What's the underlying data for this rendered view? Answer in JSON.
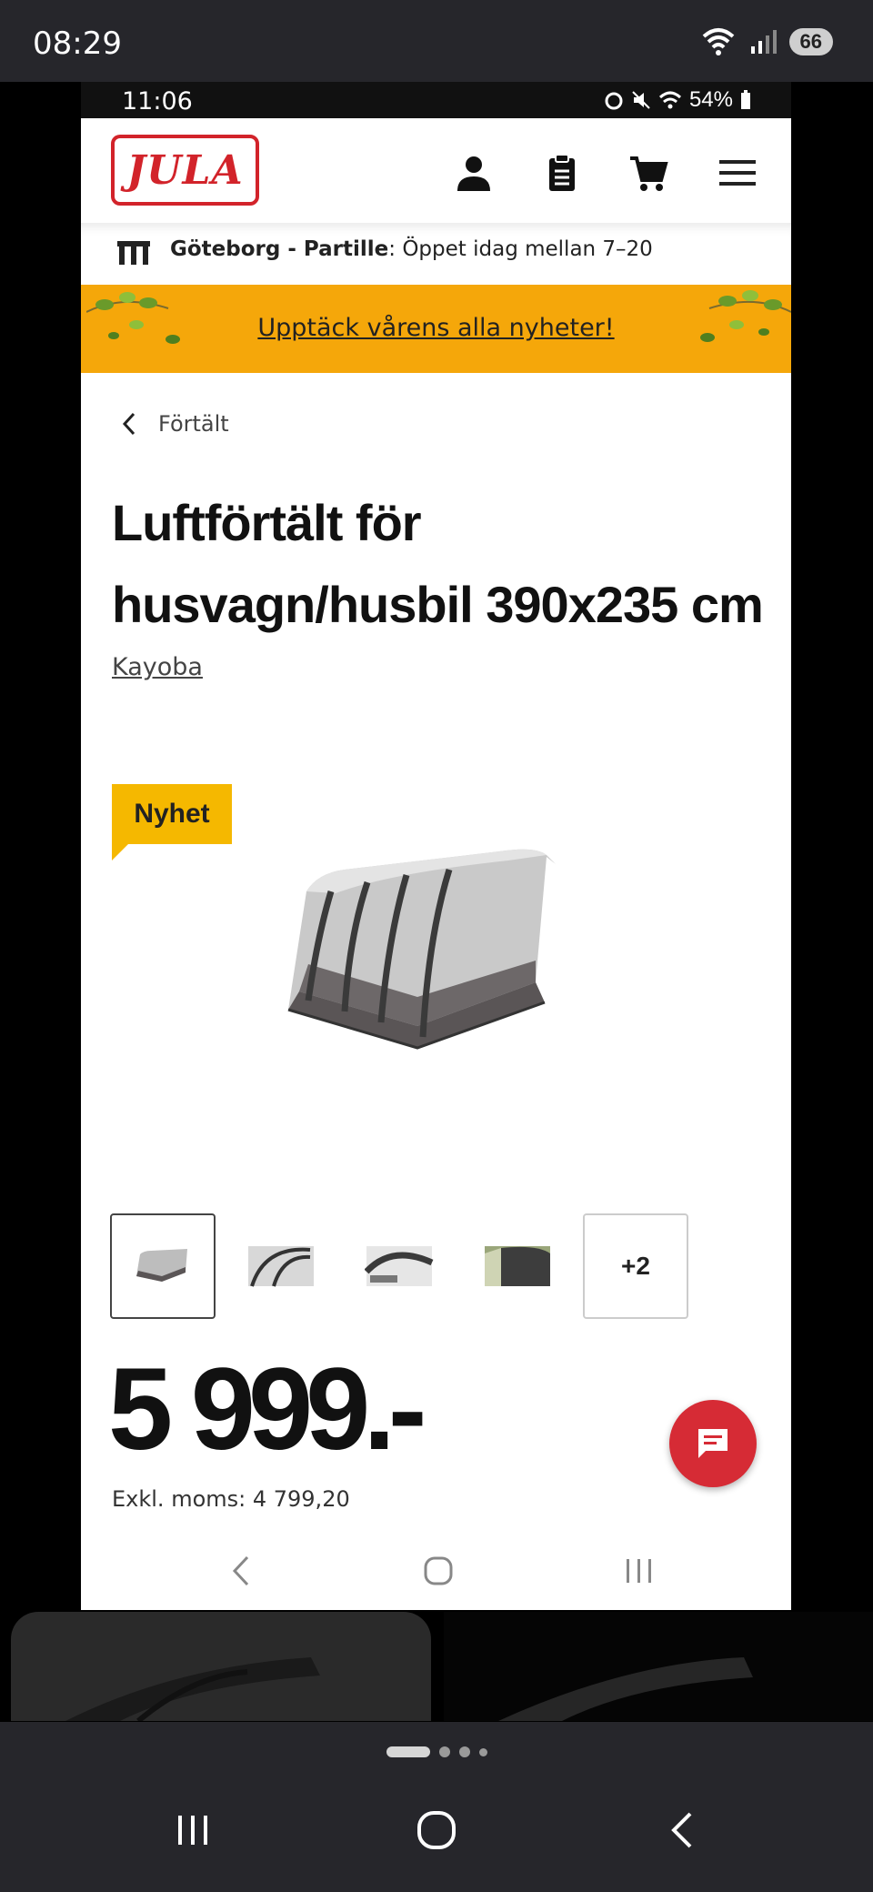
{
  "outer_status": {
    "time": "08:29",
    "battery": "66"
  },
  "inner_status": {
    "time": "11:06",
    "battery": "54%"
  },
  "header": {
    "logo": "JULA"
  },
  "store": {
    "name": "Göteborg - Partille",
    "hours": ": Öppet idag mellan 7–20"
  },
  "promo": {
    "link": "Upptäck vårens alla nyheter!"
  },
  "breadcrumb": {
    "label": "Förtält"
  },
  "product": {
    "title_line1": "Luftförtält för",
    "title_line2": "husvagn/husbil 390x235 cm",
    "brand": "Kayoba",
    "badge": "Nyhet",
    "more_images": "+2",
    "price": "5 999.-",
    "exkl_moms": "Exkl. moms: 4 799,20"
  },
  "colors": {
    "brand_red": "#d2232a",
    "promo_yellow": "#f5a70a",
    "badge_yellow": "#f5b800",
    "chat_red": "#d62b35"
  },
  "icons": [
    "user-icon",
    "clipboard-icon",
    "cart-icon",
    "menu-icon",
    "store-icon",
    "chevron-left-icon",
    "chat-icon"
  ]
}
